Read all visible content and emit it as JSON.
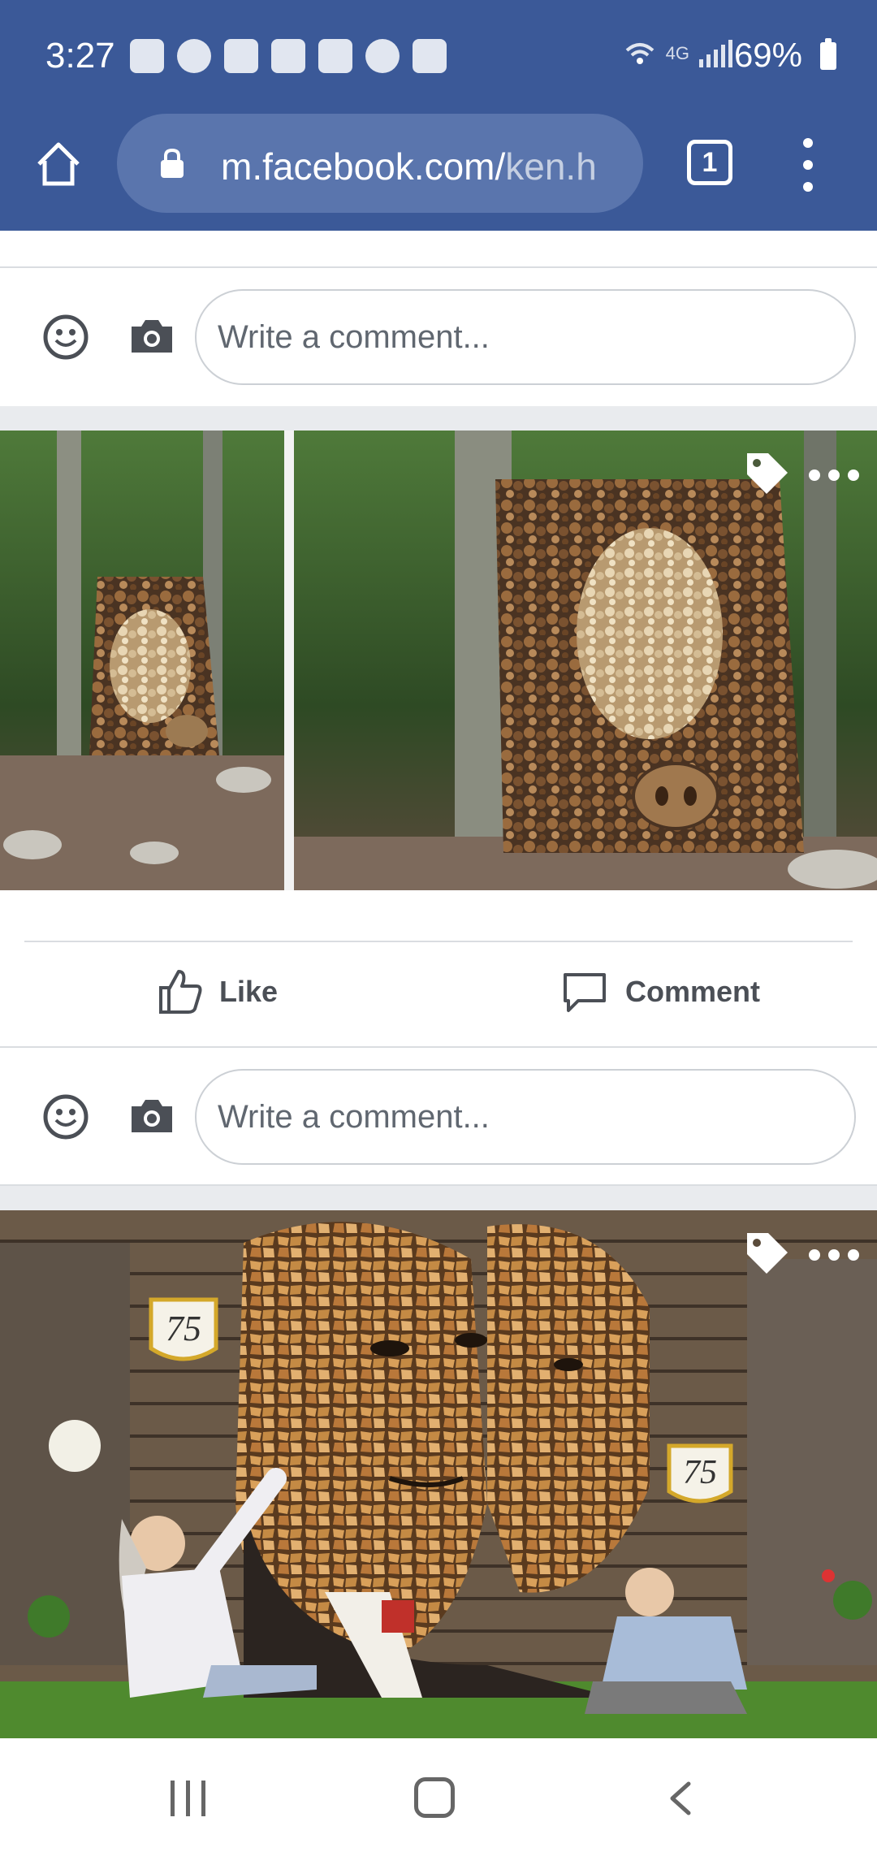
{
  "status_bar": {
    "time": "3:27",
    "network": "4G",
    "battery": "69%"
  },
  "browser": {
    "url_main": "m.facebook.com/",
    "url_path": "ken.h",
    "tab_count": "1"
  },
  "comment_composer": {
    "placeholder": "Write a comment..."
  },
  "post_actions": {
    "like_label": "Like",
    "comment_label": "Comment"
  },
  "colors": {
    "brand": "#3b5998",
    "action_text": "#4b4f56"
  }
}
